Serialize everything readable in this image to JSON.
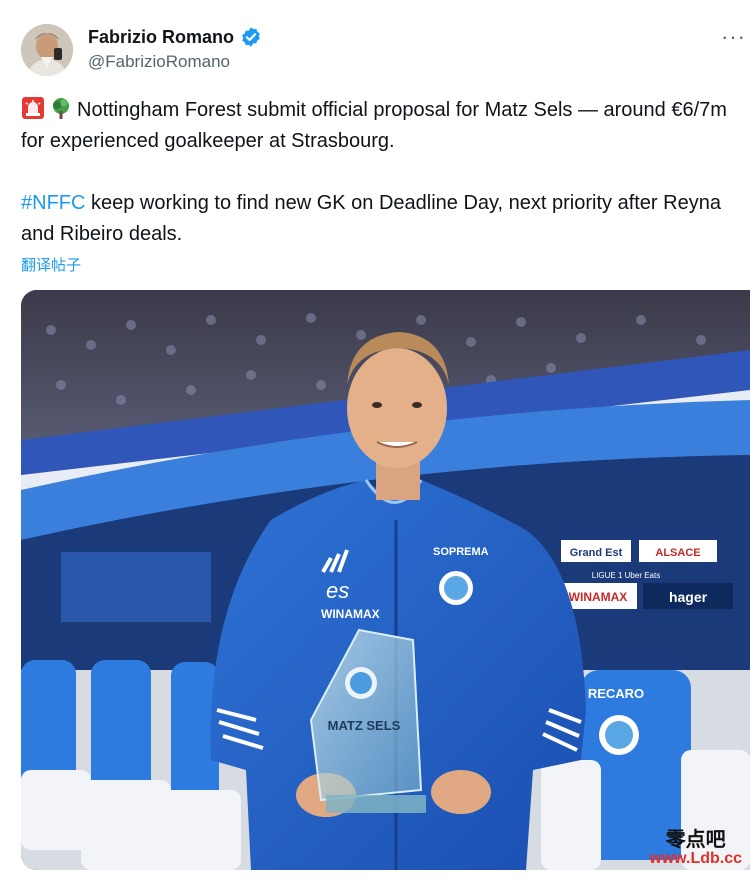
{
  "tweet": {
    "author": {
      "display_name": "Fabrizio Romano",
      "handle": "@FabrizioRomano",
      "verified": true
    },
    "more_icon": "more-horizontal-icon",
    "emojis": [
      "siren-emoji",
      "tree-emoji"
    ],
    "text_line1": "Nottingham Forest submit official proposal for Matz Sels — around €6/7m for experienced goalkeeper at Strasbourg.",
    "hashtag": "#NFFC",
    "text_line2": " keep working to find new GK on Deadline Day, next priority after Reyna and Ribeiro deals.",
    "translate_link": "翻译帖子",
    "colors": {
      "link": "#1d9bf0",
      "text": "#0f1419",
      "secondary": "#536471"
    }
  },
  "photo": {
    "boards": [
      "WINAMAX",
      "hager",
      "Grand Est",
      "ALSACE",
      "SOPREMA",
      "RECARO",
      "LIGUE 1 Uber Eats"
    ],
    "trophy_text": "MATZ SELS",
    "jersey_sponsor": "WINAMAX",
    "jersey_brand": "SOPREMA",
    "jersey_es": "es"
  },
  "watermark": {
    "cn": "零点吧",
    "url": "www.Ldb.cc"
  }
}
